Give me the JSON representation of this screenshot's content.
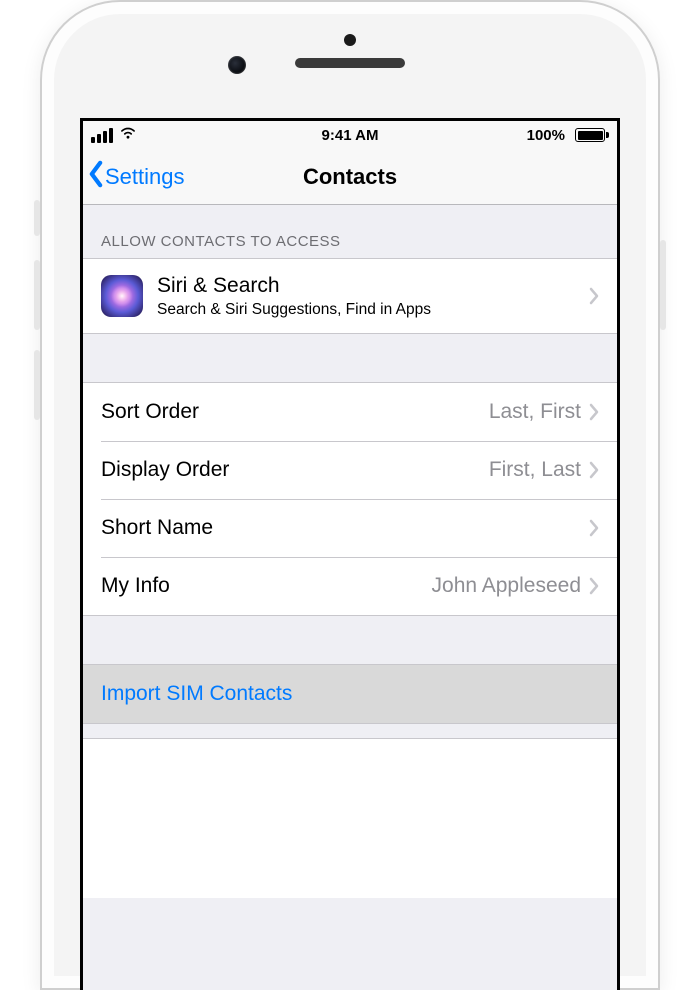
{
  "statusbar": {
    "time": "9:41 AM",
    "battery": "100%"
  },
  "navbar": {
    "back_label": "Settings",
    "title": "Contacts"
  },
  "section_access": {
    "header": "Allow Contacts to Access",
    "siri_title": "Siri & Search",
    "siri_subtitle": "Search & Siri Suggestions, Find in Apps"
  },
  "settings": {
    "sort_order": {
      "label": "Sort Order",
      "value": "Last, First"
    },
    "display_order": {
      "label": "Display Order",
      "value": "First, Last"
    },
    "short_name": {
      "label": "Short Name",
      "value": ""
    },
    "my_info": {
      "label": "My Info",
      "value": "John Appleseed"
    }
  },
  "action": {
    "import_label": "Import SIM Contacts"
  }
}
